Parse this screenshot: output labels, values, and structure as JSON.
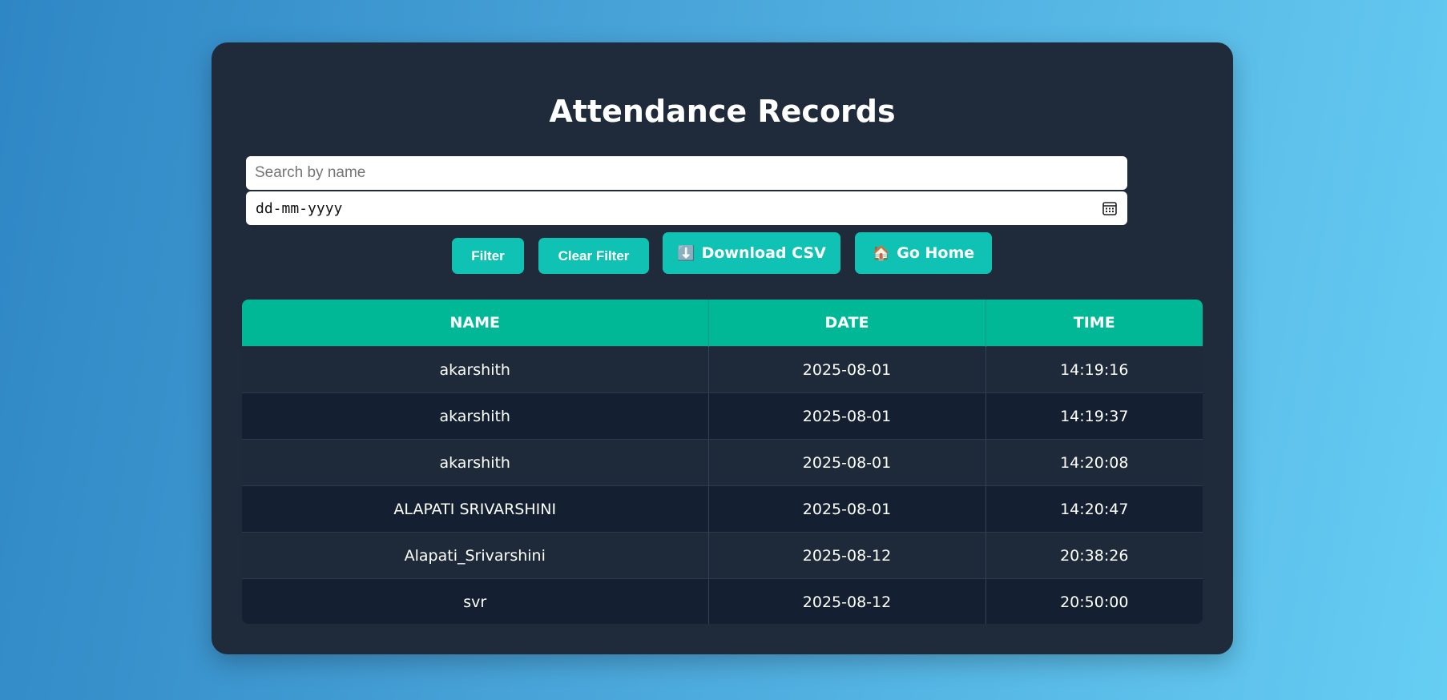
{
  "page": {
    "title": "Attendance Records"
  },
  "filters": {
    "search_placeholder": "Search by name",
    "search_value": "",
    "date_placeholder": "dd-mm-yyyy"
  },
  "buttons": {
    "filter": "Filter",
    "clear_filter": "Clear Filter",
    "download_csv": "Download CSV",
    "download_icon": "⬇️",
    "go_home": "Go Home",
    "home_icon": "🏠"
  },
  "table": {
    "columns": [
      "NAME",
      "DATE",
      "TIME"
    ],
    "rows": [
      {
        "name": "akarshith",
        "date": "2025-08-01",
        "time": "14:19:16"
      },
      {
        "name": "akarshith",
        "date": "2025-08-01",
        "time": "14:19:37"
      },
      {
        "name": "akarshith",
        "date": "2025-08-01",
        "time": "14:20:08"
      },
      {
        "name": "ALAPATI SRIVARSHINI",
        "date": "2025-08-01",
        "time": "14:20:47"
      },
      {
        "name": "Alapati_Srivarshini",
        "date": "2025-08-12",
        "time": "20:38:26"
      },
      {
        "name": "svr",
        "date": "2025-08-12",
        "time": "20:50:00"
      }
    ]
  },
  "colors": {
    "card_background": "#1f2b3a",
    "accent_button": "#10c2b4",
    "table_header": "#00b896",
    "row_odd": "#1e2a3a",
    "row_even": "#142031"
  }
}
